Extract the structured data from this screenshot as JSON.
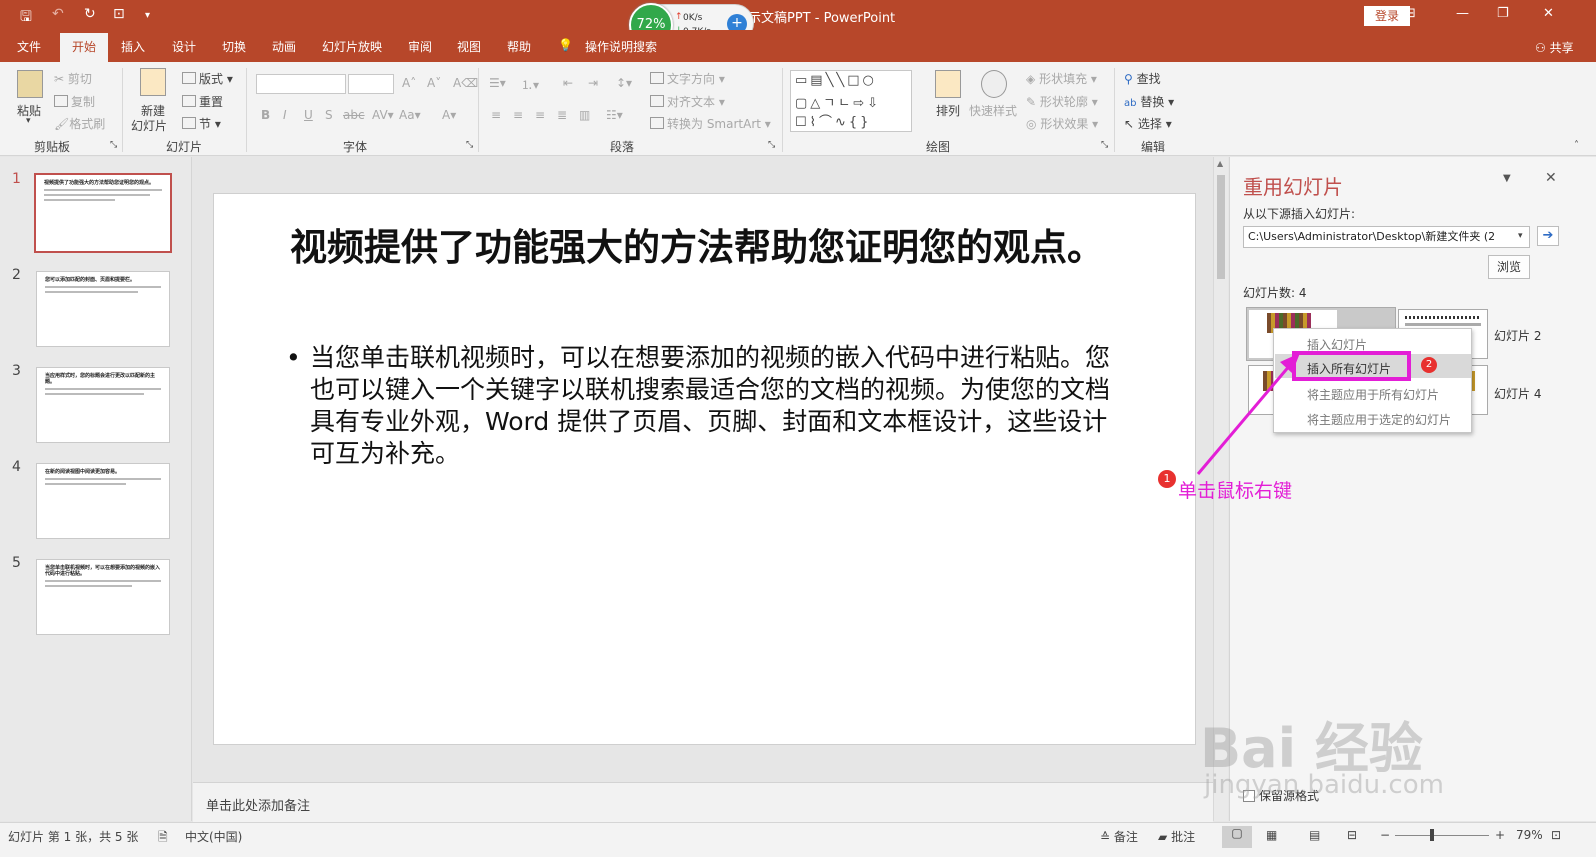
{
  "app": {
    "title": "演示文稿PPT  -  PowerPoint",
    "login_label": "登录",
    "share_label": "共享",
    "tell_me": "操作说明搜索"
  },
  "net": {
    "percent": "72%",
    "up": "0K/s",
    "down": "0.7K/s"
  },
  "tabs": [
    "文件",
    "开始",
    "插入",
    "设计",
    "切换",
    "动画",
    "幻灯片放映",
    "审阅",
    "视图",
    "帮助"
  ],
  "ribbon": {
    "clipboard": {
      "group": "剪贴板",
      "paste": "粘贴",
      "cut": "剪切",
      "copy": "复制",
      "format_painter": "格式刷"
    },
    "slides": {
      "group": "幻灯片",
      "new_slide": "新建",
      "new_slide2": "幻灯片",
      "layout": "版式",
      "reset": "重置",
      "section": "节"
    },
    "font": {
      "group": "字体"
    },
    "paragraph": {
      "group": "段落",
      "text_direction": "文字方向",
      "align_text": "对齐文本",
      "smartart": "转换为 SmartArt"
    },
    "drawing": {
      "group": "绘图",
      "arrange": "排列",
      "quick_styles": "快速样式",
      "fill": "形状填充",
      "outline": "形状轮廓",
      "effects": "形状效果"
    },
    "editing": {
      "group": "编辑",
      "find": "查找",
      "replace": "替换",
      "select": "选择"
    }
  },
  "thumbnails": [
    {
      "num": "1",
      "title": "视频提供了功能强大的方法帮助您证明您的观点。"
    },
    {
      "num": "2",
      "title": "您可以添加匹配的封面、页眉和提要栏。"
    },
    {
      "num": "3",
      "title": "当应用样式时，您的标题会进行更改以匹配新的主题。"
    },
    {
      "num": "4",
      "title": "在新的阅读视图中阅读更加容易。"
    },
    {
      "num": "5",
      "title": "当您单击联机视频时，可以在想要添加的视频的嵌入代码中进行粘贴。"
    }
  ],
  "slide": {
    "title": "视频提供了功能强大的方法帮助您证明您的观点。",
    "body": "当您单击联机视频时，可以在想要添加的视频的嵌入代码中进行粘贴。您也可以键入一个关键字以联机搜索最适合您的文档的视频。为使您的文档具有专业外观，Word 提供了页眉、页脚、封面和文本框设计，这些设计可互为补充。"
  },
  "notes_placeholder": "单击此处添加备注",
  "reuse": {
    "title": "重用幻灯片",
    "source_label": "从以下源插入幻灯片:",
    "source_value": "C:\\Users\\Administrator\\Desktop\\新建文件夹 (2",
    "browse": "浏览",
    "count": "幻灯片数: 4",
    "slide2": "幻灯片 2",
    "slide4": "幻灯片 4",
    "keep_format": "保留源格式"
  },
  "context_menu": {
    "insert_slide": "插入幻灯片",
    "insert_all": "插入所有幻灯片",
    "apply_theme_all": "将主题应用于所有幻灯片",
    "apply_theme_selected": "将主题应用于选定的幻灯片"
  },
  "annotation": {
    "badge1": "1",
    "text": "单击鼠标右键",
    "badge2": "2"
  },
  "watermark": {
    "brand": "Bai 经验",
    "url": "jingyan.baidu.com"
  },
  "status": {
    "slide_info": "幻灯片 第 1 张，共 5 张",
    "language": "中文(中国)",
    "notes": "备注",
    "comments": "批注",
    "zoom": "79%"
  },
  "colors": {
    "brand": "#b7472a",
    "accent": "#c0504d",
    "highlight": "#e31ed6"
  }
}
